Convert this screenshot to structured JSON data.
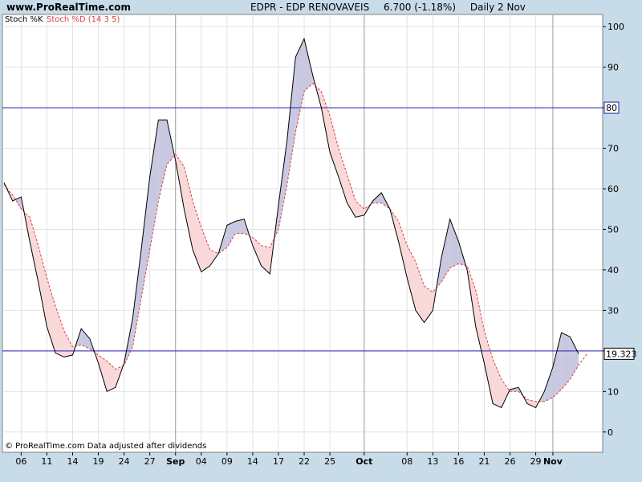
{
  "header": {
    "site": "www.ProRealTime.com",
    "symbol": "EDPR - EDP RENOVAVEIS",
    "price": "6.700 (-1.18%)",
    "period": "Daily  2 Nov"
  },
  "legend": {
    "k_label": "Stoch %K",
    "d_label": "Stoch %D (14 3 5)"
  },
  "footer": "© ProRealTime.com  Data adjusted after dividends",
  "colors": {
    "k_line": "#000000",
    "d_line": "#e04040",
    "above_fill": "#c8c8e0",
    "below_fill": "#f8d8d8",
    "level_line": "#2020b0"
  },
  "chart_data": {
    "type": "line",
    "ylim": [
      -5,
      103
    ],
    "y_ticks": [
      0,
      10,
      20,
      30,
      40,
      50,
      60,
      70,
      80,
      90,
      100
    ],
    "x_ticks": [
      {
        "label": "06",
        "i": 2,
        "bold": false
      },
      {
        "label": "11",
        "i": 5,
        "bold": false
      },
      {
        "label": "14",
        "i": 8,
        "bold": false
      },
      {
        "label": "19",
        "i": 11,
        "bold": false
      },
      {
        "label": "24",
        "i": 14,
        "bold": false
      },
      {
        "label": "27",
        "i": 17,
        "bold": false
      },
      {
        "label": "Sep",
        "i": 20,
        "bold": true
      },
      {
        "label": "04",
        "i": 23,
        "bold": false
      },
      {
        "label": "09",
        "i": 26,
        "bold": false
      },
      {
        "label": "14",
        "i": 29,
        "bold": false
      },
      {
        "label": "17",
        "i": 32,
        "bold": false
      },
      {
        "label": "22",
        "i": 35,
        "bold": false
      },
      {
        "label": "25",
        "i": 38,
        "bold": false
      },
      {
        "label": "Oct",
        "i": 42,
        "bold": true
      },
      {
        "label": "08",
        "i": 47,
        "bold": false
      },
      {
        "label": "13",
        "i": 50,
        "bold": false
      },
      {
        "label": "16",
        "i": 53,
        "bold": false
      },
      {
        "label": "21",
        "i": 56,
        "bold": false
      },
      {
        "label": "26",
        "i": 59,
        "bold": false
      },
      {
        "label": "29",
        "i": 62,
        "bold": false
      },
      {
        "label": "Nov",
        "i": 64,
        "bold": true
      }
    ],
    "month_lines": [
      20,
      42,
      64
    ],
    "levels": [
      {
        "value": 80,
        "label": "80"
      },
      {
        "value": 20,
        "label": ""
      }
    ],
    "last_value_label": "19.323",
    "series": [
      {
        "name": "Stoch %K",
        "values": [
          61.5,
          57,
          58,
          47,
          37,
          26,
          19.5,
          18.5,
          19,
          25.5,
          23,
          17,
          10,
          11,
          17,
          28,
          45,
          63,
          77,
          77,
          67,
          55,
          45,
          39.5,
          41,
          44,
          51,
          52,
          52.5,
          46,
          41,
          39,
          56,
          72,
          92.5,
          97,
          88,
          80,
          69,
          63,
          56.5,
          53,
          53.5,
          57,
          59,
          55,
          47,
          38,
          30,
          27,
          30,
          43,
          52.5,
          47,
          40,
          26,
          17,
          7,
          6,
          10.5,
          11,
          7,
          6,
          10,
          16,
          24.5,
          23.5,
          19.3
        ]
      },
      {
        "name": "Stoch %D (14 3 5)",
        "values": [
          61,
          58.5,
          55,
          53,
          46,
          38,
          31,
          25,
          21,
          21.5,
          20.5,
          19,
          17.5,
          15.5,
          16.5,
          21,
          33,
          45,
          57,
          66,
          68.5,
          65.5,
          57,
          50.5,
          45,
          44,
          45.5,
          49,
          49,
          48,
          46,
          45.5,
          50,
          61,
          74,
          84,
          86,
          84,
          78,
          70,
          63.5,
          57,
          55,
          56.5,
          56.5,
          55,
          52,
          46,
          42,
          36,
          34.5,
          37,
          40.5,
          41.5,
          41,
          35,
          25,
          18,
          13,
          10,
          10,
          8,
          7.5,
          7.5,
          8.5,
          10.5,
          13,
          16.5,
          19.3
        ]
      }
    ]
  }
}
